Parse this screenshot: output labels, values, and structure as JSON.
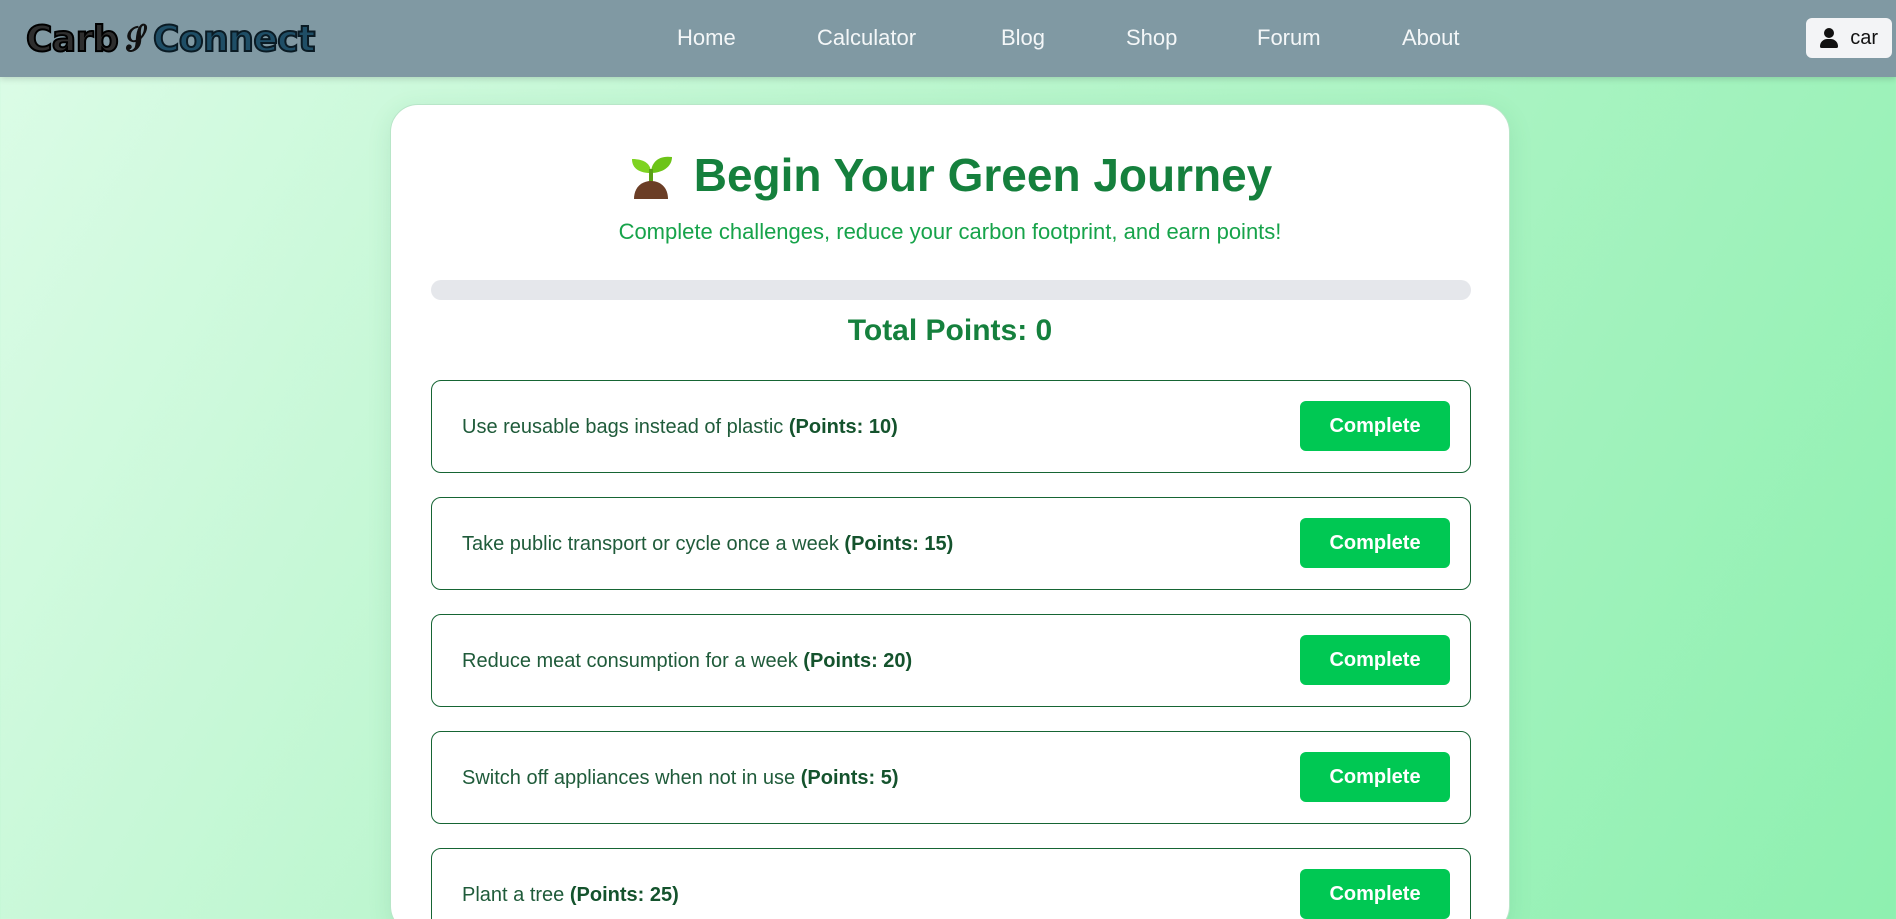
{
  "brand": {
    "part1": "Carb",
    "link_glyph": "𝓢",
    "part2": "Connect"
  },
  "nav": {
    "items": [
      {
        "label": "Home"
      },
      {
        "label": "Calculator"
      },
      {
        "label": "Blog"
      },
      {
        "label": "Shop"
      },
      {
        "label": "Forum"
      },
      {
        "label": "About"
      }
    ]
  },
  "user": {
    "name": "car",
    "icon": "user-icon"
  },
  "page": {
    "title": "Begin Your Green Journey",
    "title_icon": "sprout-icon",
    "subtitle": "Complete challenges, reduce your carbon footprint, and earn points!",
    "progress_percent": 0,
    "total_points_label": "Total Points:",
    "total_points": "0"
  },
  "challenges": [
    {
      "text": "Use reusable bags instead of plastic",
      "points_label": "(Points: 10)",
      "button": "Complete"
    },
    {
      "text": "Take public transport or cycle once a week",
      "points_label": "(Points: 15)",
      "button": "Complete"
    },
    {
      "text": "Reduce meat consumption for a week",
      "points_label": "(Points: 20)",
      "button": "Complete"
    },
    {
      "text": "Switch off appliances when not in use",
      "points_label": "(Points: 5)",
      "button": "Complete"
    },
    {
      "text": "Plant a tree",
      "points_label": "(Points: 25)",
      "button": "Complete"
    }
  ],
  "colors": {
    "navbar": "#8099a3",
    "accent_green": "#15803d",
    "button_green": "#00c853"
  }
}
